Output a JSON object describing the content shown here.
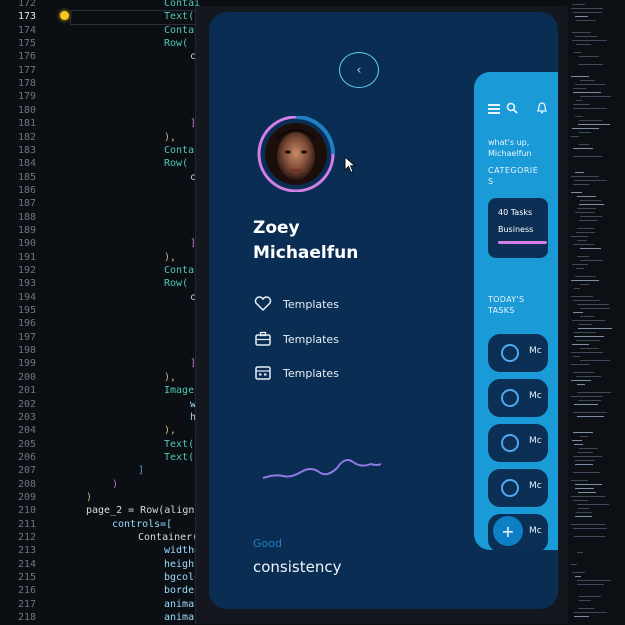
{
  "editor": {
    "line_numbers": [
      "172",
      "173",
      "174",
      "175",
      "176",
      "177",
      "178",
      "179",
      "180",
      "181",
      "182",
      "183",
      "184",
      "185",
      "186",
      "187",
      "188",
      "189",
      "190",
      "191",
      "192",
      "193",
      "194",
      "195",
      "196",
      "197",
      "198",
      "199",
      "200",
      "201",
      "202",
      "203",
      "204",
      "205",
      "206",
      "207",
      "208",
      "209",
      "210",
      "211",
      "212",
      "213",
      "214",
      "215",
      "216",
      "217",
      "218"
    ],
    "active_line": "173",
    "code_lines": [
      {
        "text": "Contai",
        "indent": 164,
        "cls": "cls"
      },
      {
        "text": "Text(",
        "indent": 164,
        "cls": "cls"
      },
      {
        "text": "Contai",
        "indent": 164,
        "cls": "cls"
      },
      {
        "text": "Row(",
        "indent": 164,
        "cls": "cls"
      },
      {
        "text": "co",
        "indent": 190,
        "cls": "var"
      },
      {
        "text": "",
        "indent": 190,
        "cls": ""
      },
      {
        "text": "",
        "indent": 190,
        "cls": ""
      },
      {
        "text": "",
        "indent": 190,
        "cls": ""
      },
      {
        "text": "",
        "indent": 190,
        "cls": ""
      },
      {
        "text": "]",
        "indent": 190,
        "cls": "mag"
      },
      {
        "text": "),",
        "indent": 164,
        "cls": "brk"
      },
      {
        "text": "Contai",
        "indent": 164,
        "cls": "cls"
      },
      {
        "text": "Row(",
        "indent": 164,
        "cls": "cls"
      },
      {
        "text": "co",
        "indent": 190,
        "cls": "var"
      },
      {
        "text": "",
        "indent": 190,
        "cls": ""
      },
      {
        "text": "",
        "indent": 190,
        "cls": ""
      },
      {
        "text": "",
        "indent": 190,
        "cls": ""
      },
      {
        "text": "",
        "indent": 190,
        "cls": ""
      },
      {
        "text": "]",
        "indent": 190,
        "cls": "mag"
      },
      {
        "text": "),",
        "indent": 164,
        "cls": "brk"
      },
      {
        "text": "Contai",
        "indent": 164,
        "cls": "cls"
      },
      {
        "text": "Row(",
        "indent": 164,
        "cls": "cls"
      },
      {
        "text": "co",
        "indent": 190,
        "cls": "var"
      },
      {
        "text": "",
        "indent": 190,
        "cls": ""
      },
      {
        "text": "",
        "indent": 190,
        "cls": ""
      },
      {
        "text": "",
        "indent": 190,
        "cls": ""
      },
      {
        "text": "",
        "indent": 190,
        "cls": ""
      },
      {
        "text": "]",
        "indent": 190,
        "cls": "mag"
      },
      {
        "text": "),",
        "indent": 164,
        "cls": "brk"
      },
      {
        "text": "Image(",
        "indent": 164,
        "cls": "cls"
      },
      {
        "text": "wi",
        "indent": 190,
        "cls": "var"
      },
      {
        "text": "he",
        "indent": 190,
        "cls": "var"
      },
      {
        "text": "),",
        "indent": 164,
        "cls": "brk"
      },
      {
        "text": "Text(",
        "indent": 164,
        "cls": "cls"
      },
      {
        "text": "Text(",
        "indent": 164,
        "cls": "cls"
      },
      {
        "text": "]",
        "indent": 138,
        "cls": "blu"
      },
      {
        "text": ")",
        "indent": 112,
        "cls": "mag"
      },
      {
        "text": ")",
        "indent": 86,
        "cls": "brk"
      },
      {
        "text": "page_2 = Row(align",
        "indent": 86,
        "cls": ""
      },
      {
        "text": "controls=[",
        "indent": 112,
        "cls": "var"
      },
      {
        "text": "Container(",
        "indent": 138,
        "cls": ""
      },
      {
        "text": "width=",
        "indent": 164,
        "cls": "var"
      },
      {
        "text": "height",
        "indent": 164,
        "cls": "var"
      },
      {
        "text": "bgcolo",
        "indent": 164,
        "cls": "var"
      },
      {
        "text": "border",
        "indent": 164,
        "cls": "var"
      },
      {
        "text": "animat",
        "indent": 164,
        "cls": "var"
      },
      {
        "text": "animat",
        "indent": 164,
        "cls": "var"
      }
    ]
  },
  "app": {
    "back_button_icon": "back-arrow",
    "user_name": "Zoey\nMichaelfun",
    "menu": [
      {
        "icon": "heart-icon",
        "label": "Templates"
      },
      {
        "icon": "briefcase-icon",
        "label": "Templates"
      },
      {
        "icon": "calendar-icon",
        "label": "Templates"
      }
    ],
    "good_label": "Good",
    "consistency_label": "consistency",
    "colors": {
      "phone_bg": "#0a2d53",
      "panel_bg": "#1a9ad6",
      "card_bg": "#0b2f55",
      "accent_pink": "#d57ee8",
      "accent_cyan": "#5fd0f5"
    }
  },
  "panel": {
    "greeting": "what's up,\nMichaelfun",
    "categories_label": "CATEGORIE\nS",
    "category_card": {
      "count": "40 Tasks",
      "name": "Business",
      "progress": 0.85
    },
    "todays_tasks_label": "TODAY'S\nTASKS",
    "tasks": [
      {
        "label": "Mc"
      },
      {
        "label": "Mc"
      },
      {
        "label": "Mc"
      },
      {
        "label": "Mc"
      },
      {
        "label": "Mc"
      }
    ],
    "fab_label": "+"
  }
}
